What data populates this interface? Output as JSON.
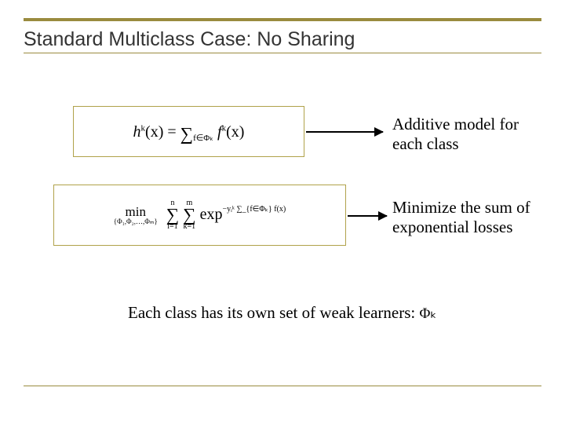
{
  "title": "Standard Multiclass Case: No Sharing",
  "equations": {
    "additive": {
      "lhs_h": "h",
      "lhs_sup": "k",
      "lhs_arg": "(x)",
      "eq": "=",
      "sum_sub": "f∈Φₖ",
      "rhs_f": "f",
      "rhs_sup": "k",
      "rhs_arg": "(x)"
    },
    "loss": {
      "min": "min",
      "min_sub": "{Φ₁,Φ₂,…,Φₘ}",
      "sum1_top": "n",
      "sum1_bottom": "i=1",
      "sum2_top": "m",
      "sum2_bottom": "k=1",
      "exp": "exp",
      "exp_sup": "−yᵢᵏ ∑_{f∈Φₖ} f(x)"
    }
  },
  "callouts": {
    "additive": "Additive model for each class",
    "loss": "Minimize the sum of exponential losses"
  },
  "bottom_line": {
    "text": "Each class has its own set of weak learners:",
    "symbol": "Φₖ"
  }
}
